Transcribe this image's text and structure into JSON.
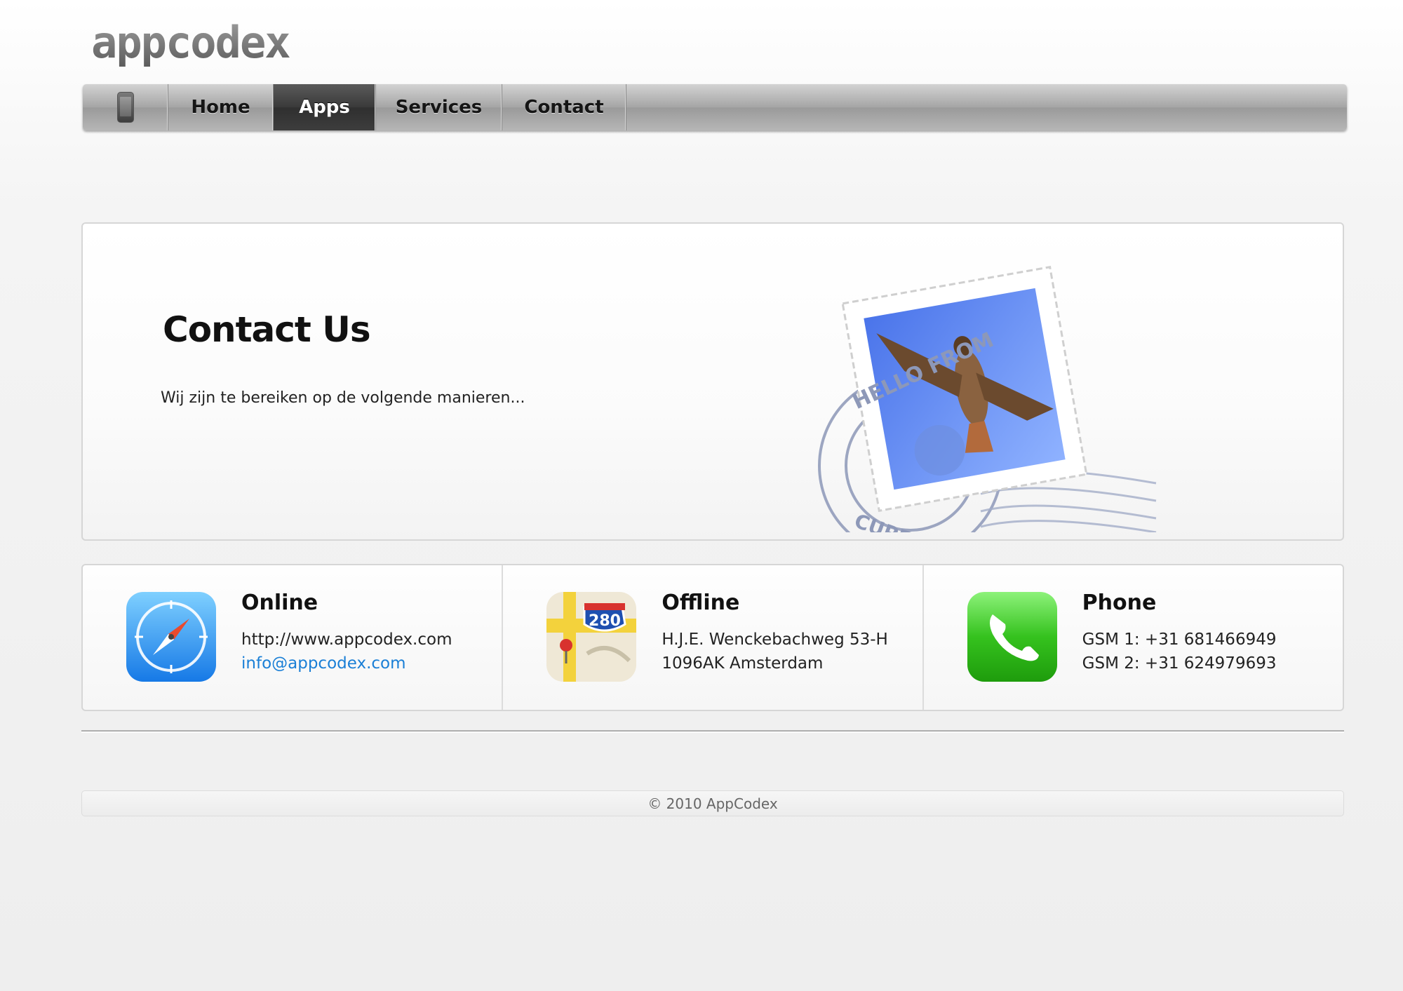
{
  "site": {
    "logo_text": "appcodex"
  },
  "nav": {
    "items": [
      {
        "label": "Home"
      },
      {
        "label": "Apps"
      },
      {
        "label": "Services"
      },
      {
        "label": "Contact"
      }
    ]
  },
  "hero": {
    "title": "Contact Us",
    "subtitle": "Wij zijn te bereiken op de volgende manieren..."
  },
  "cards": [
    {
      "title": "Online",
      "line1": "http://www.appcodex.com",
      "line2": "info@appcodex.com",
      "icon": "safari-compass-icon"
    },
    {
      "title": "Offline",
      "line1": "H.J.E. Wenckebachweg 53-H",
      "line2": "1096AK Amsterdam",
      "icon": "maps-icon",
      "road_sign": "280"
    },
    {
      "title": "Phone",
      "line1": "GSM 1: +31 681466949",
      "line2": "GSM 2: +31 624979693",
      "icon": "phone-icon"
    }
  ],
  "footer": {
    "copyright": "© 2010 AppCodex"
  },
  "colors": {
    "link": "#1a7fd6",
    "nav_active": "#3a3a3a",
    "phone_green": "#35c21e"
  }
}
